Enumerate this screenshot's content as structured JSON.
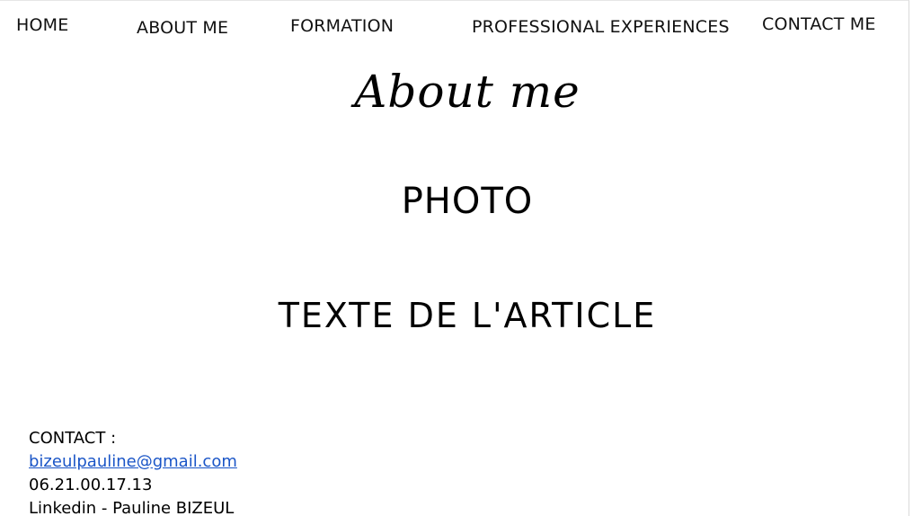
{
  "nav": {
    "home": "HOME",
    "about": "ABOUT ME",
    "formation": "FORMATION",
    "professional": "PROFESSIONAL EXPERIENCES",
    "contact": "CONTACT ME"
  },
  "main": {
    "title": "About me",
    "photo_placeholder": "PHOTO",
    "article_placeholder": "TEXTE DE L'ARTICLE"
  },
  "footer": {
    "contact_heading": "CONTACT   :",
    "email": "bizeulpauline@gmail.com",
    "phone": "06.21.00.17.13",
    "linkedin_label": "Linkedin",
    "linkedin_rest": " - Pauline BIZEUL"
  },
  "colors": {
    "link": "#1a55c7",
    "text": "#000000",
    "spellcheck_underline": "#d23b3b"
  }
}
